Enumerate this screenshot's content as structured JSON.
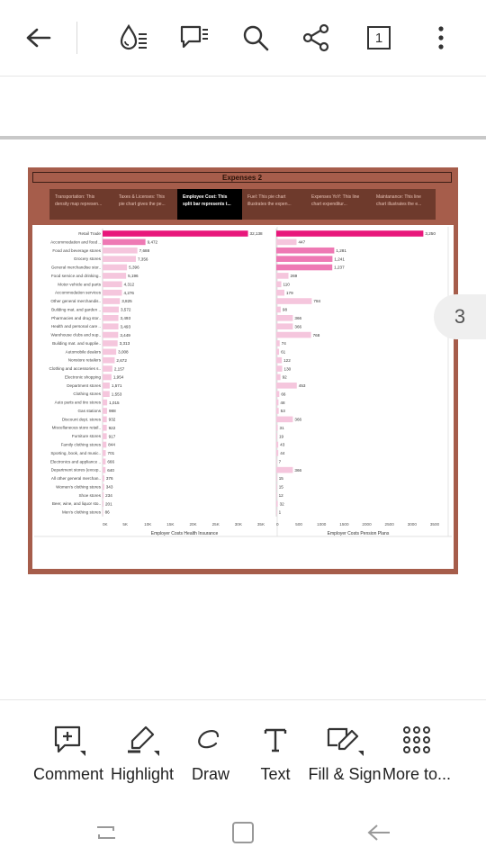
{
  "toolbar": {
    "icons": [
      "back-arrow-icon",
      "read-mode-icon",
      "comments-icon",
      "search-icon",
      "share-icon",
      "page-count-icon",
      "more-options-icon"
    ],
    "page_count": "1"
  },
  "document": {
    "title": "Expenses 2",
    "tabs": [
      {
        "label": "Transportation: This density map represen..."
      },
      {
        "label": "Taxes & Licenses: This pie chart gives the pe..."
      },
      {
        "label": "Employee Cost: This split bar represents t..."
      },
      {
        "label": "Fuel: This pie chart illustrates the expen..."
      },
      {
        "label": "Expenses YoY: This line chart expenditur..."
      },
      {
        "label": "Maintanance: This line chart illustrates the e..."
      }
    ],
    "active_tab": 2,
    "colors": {
      "frame": "#a65d4b",
      "tab_bar": "#6e3a2c",
      "bar_top": "#e8177b",
      "bar_mid": "#ee79b4",
      "bar_light": "#f5c6dd"
    }
  },
  "chart_data": {
    "type": "bar",
    "orientation": "horizontal",
    "categories": [
      "Retail Trade",
      "Accommodation and food ..",
      "Food and beverage stores",
      "Grocery stores",
      "General merchandise stor..",
      "Food service and drinking..",
      "Motor vehicle and parts",
      "Accommodation services",
      "Other general merchandis..",
      "Building mat. and garden ..",
      "Pharmacies and drug stor..",
      "Health and personal care ..",
      "Warehouse clubs and sup..",
      "Building mat. and supplie..",
      "Automobile dealers",
      "Nonstore retailers",
      "Clothing and accessories s..",
      "Electronic shopping",
      "Department stores",
      "Clothing stores",
      "Auto parts and tire stores",
      "Gas stations",
      "Discount dept. stores",
      "Miscellaneous store retail..",
      "Furniture stores",
      "Family clothing stores",
      "Sporting, book, and music..",
      "Electronics and appliance ..",
      "Department stores (excep..",
      "All other general merchan..",
      "Women's clothing stores",
      "Shoe stores",
      "Beer, wine, and liquor sto..",
      "Men's clothing stores"
    ],
    "series": [
      {
        "name": "Employer Costs Health Insurance",
        "values": [
          32138,
          9472,
          7688,
          7356,
          5396,
          5196,
          4312,
          4276,
          3825,
          3572,
          3493,
          3493,
          3449,
          3313,
          3008,
          2672,
          2157,
          1954,
          1571,
          1553,
          1015,
          988,
          932,
          922,
          917,
          844,
          701,
          666,
          640,
          376,
          343,
          234,
          201,
          86
        ],
        "labels": [
          "32,138",
          "9,472",
          "7,688",
          "7,356",
          "5,396",
          "5,196",
          "4,312",
          "4,276",
          "3,825",
          "3,572",
          "3,493",
          "3,493",
          "3,449",
          "3,313",
          "3,008",
          "2,672",
          "2,157",
          "1,954",
          "1,571",
          "1,553",
          "1,015",
          "988",
          "932",
          "922",
          "917",
          "844",
          "701",
          "666",
          "640",
          "376",
          "343",
          "234",
          "201",
          "86"
        ]
      },
      {
        "name": "Employer Costs Pension Plans",
        "values": [
          3250,
          447,
          1281,
          1241,
          1237,
          269,
          110,
          179,
          784,
          98,
          366,
          366,
          768,
          74,
          61,
          122,
          130,
          92,
          453,
          66,
          48,
          53,
          366,
          31,
          19,
          43,
          44,
          7,
          366,
          15,
          15,
          12,
          32,
          1
        ],
        "labels": [
          "3,250",
          "447",
          "1,281",
          "1,241",
          "1,237",
          "269",
          "110",
          "179",
          "784",
          "98",
          "366",
          "366",
          "768",
          "74",
          "61",
          "122",
          "130",
          "92",
          "453",
          "66",
          "48",
          "53",
          "366",
          "31",
          "19",
          "43",
          "44",
          "7",
          "366",
          "15",
          "15",
          "12",
          "32",
          "1"
        ]
      }
    ],
    "xticks": [
      [
        "0K",
        "5K",
        "10K",
        "15K",
        "20K",
        "25K",
        "30K",
        "35K"
      ],
      [
        "0",
        "500",
        "1000",
        "1500",
        "2000",
        "2500",
        "3000",
        "3500"
      ]
    ],
    "xlim": [
      [
        0,
        37000
      ],
      [
        0,
        3700
      ]
    ]
  },
  "page_indicator": "3",
  "bottom_tools": [
    {
      "label": "Comment",
      "icon": "comment-icon"
    },
    {
      "label": "Highlight",
      "icon": "highlight-icon"
    },
    {
      "label": "Draw",
      "icon": "draw-icon"
    },
    {
      "label": "Text",
      "icon": "text-icon"
    },
    {
      "label": "Fill & Sign",
      "icon": "fill-sign-icon"
    },
    {
      "label": "More to...",
      "icon": "more-tools-icon"
    }
  ]
}
